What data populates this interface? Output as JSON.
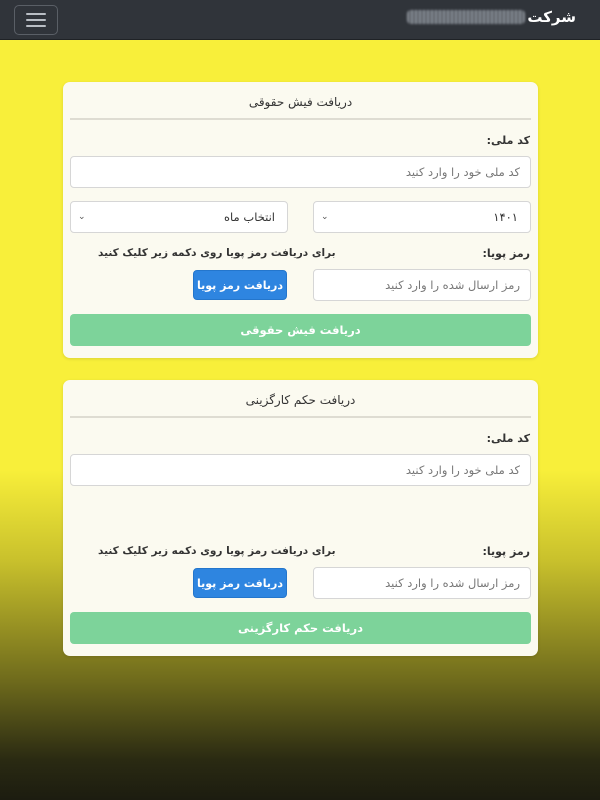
{
  "navbar": {
    "brand": "شرکت",
    "menu_icon": "hamburger-menu-icon"
  },
  "payslip": {
    "title": "دریافت فیش حقوقی",
    "national_code_label": "کد ملی:",
    "national_code_placeholder": "کد ملی خود را وارد کنید",
    "year_selected": "۱۴۰۱",
    "month_selected": "انتخاب ماه",
    "otp_label": "رمز پویا:",
    "otp_hint": "برای دریافت رمز پویا روی دکمه زیر کلیک کنید",
    "otp_placeholder": "رمز ارسال شده را وارد کنید",
    "get_otp_button": "دریافت رمز پویا",
    "submit_button": "دریافت فیش حقوقی"
  },
  "employment": {
    "title": "دریافت حکم کارگزینی",
    "national_code_label": "کد ملی:",
    "national_code_placeholder": "کد ملی خود را وارد کنید",
    "otp_label": "رمز پویا:",
    "otp_hint": "برای دریافت رمز پویا روی دکمه زیر کلیک کنید",
    "otp_placeholder": "رمز ارسال شده را وارد کنید",
    "get_otp_button": "دریافت رمز پویا",
    "submit_button": "دریافت حکم کارگزینی"
  },
  "colors": {
    "navbar": "#30343a",
    "background": "#f8ef3a",
    "primary_button": "#2e85e0",
    "submit_button": "#7dd39a"
  }
}
